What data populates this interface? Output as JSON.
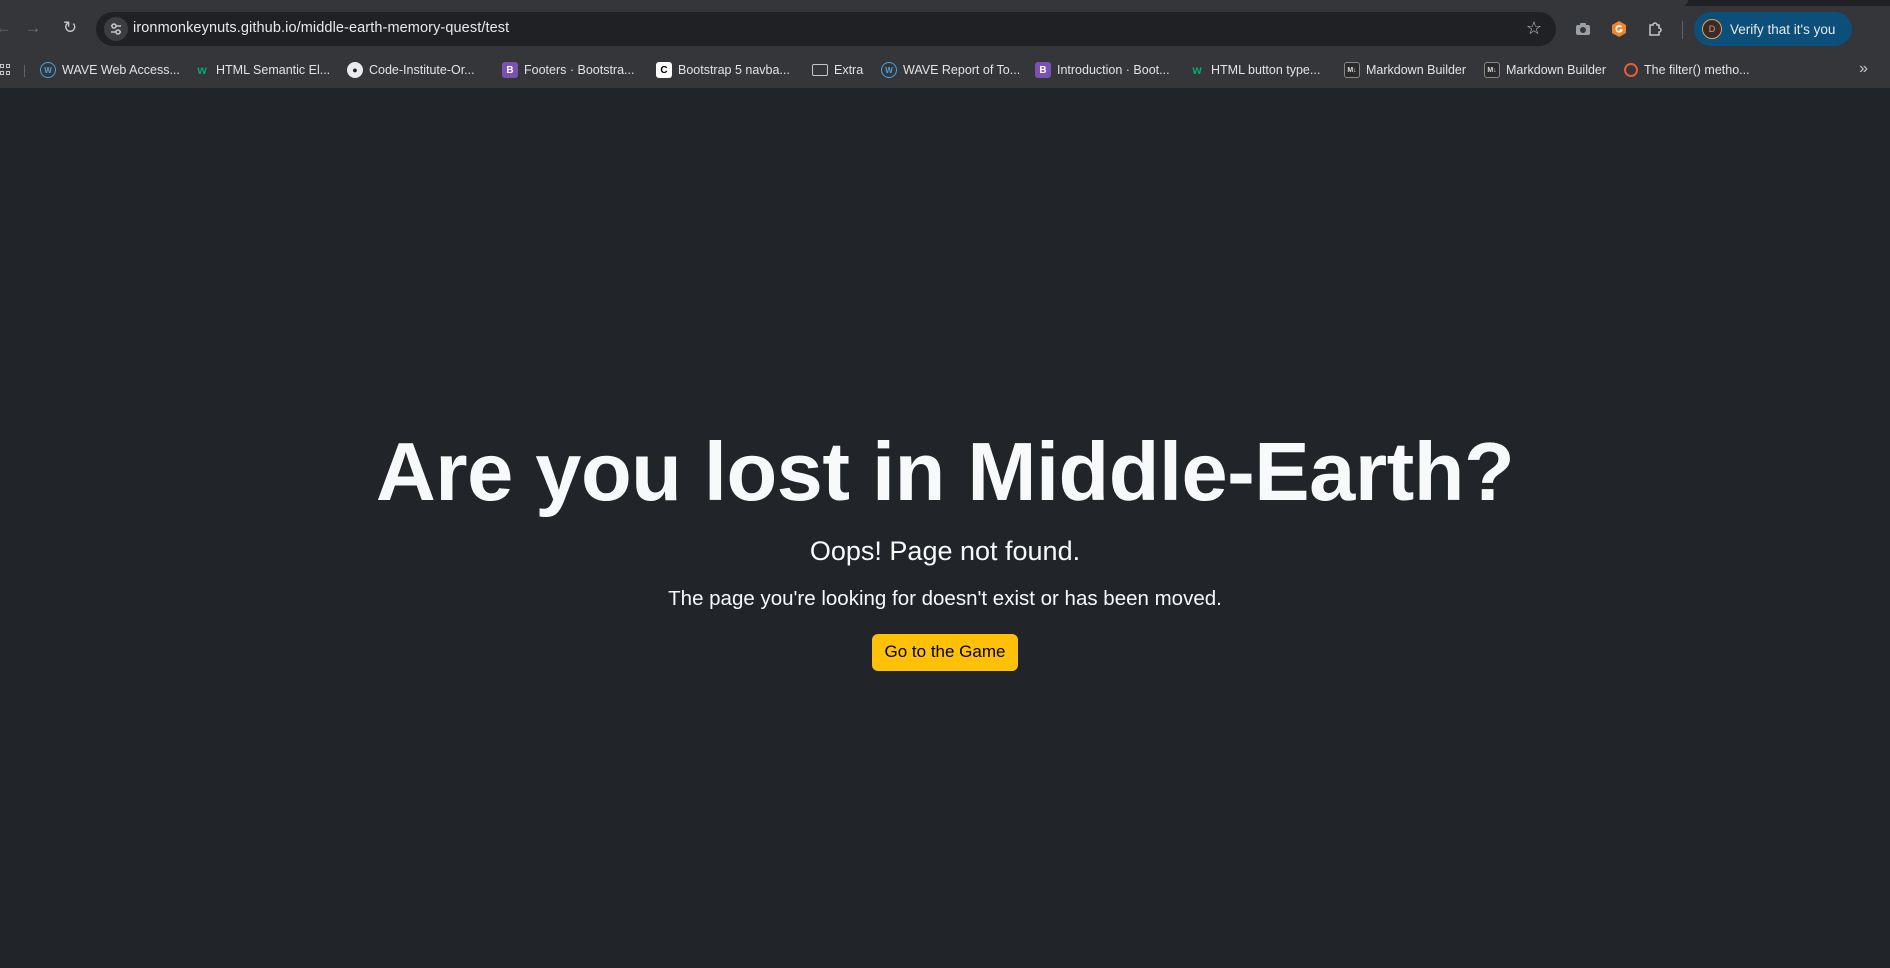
{
  "browser": {
    "url": "ironmonkeynuts.github.io/middle-earth-memory-quest/test",
    "profile_button": "Verify that it's you",
    "profile_initial": "D"
  },
  "bookmarks": [
    {
      "label": "WAVE Web Access...",
      "icon": "wave-icon"
    },
    {
      "label": "HTML Semantic El...",
      "icon": "w3schools-icon"
    },
    {
      "label": "Code-Institute-Or...",
      "icon": "github-icon"
    },
    {
      "label": "Footers · Bootstra...",
      "icon": "bootstrap-icon"
    },
    {
      "label": "Bootstrap 5 navba...",
      "icon": "codeply-icon"
    },
    {
      "label": "Extra",
      "icon": "folder-icon"
    },
    {
      "label": "WAVE Report of To...",
      "icon": "wave-icon"
    },
    {
      "label": "Introduction · Boot...",
      "icon": "bootstrap-icon"
    },
    {
      "label": "HTML button type...",
      "icon": "w3schools-icon"
    },
    {
      "label": "Markdown Builder",
      "icon": "markdown-icon"
    },
    {
      "label": "Markdown Builder",
      "icon": "markdown-icon"
    },
    {
      "label": "The filter() metho...",
      "icon": "mdn-icon"
    }
  ],
  "page": {
    "heading": "Are you lost in Middle-Earth?",
    "subheading": "Oops! Page not found.",
    "description": "The page you're looking for doesn't exist or has been moved.",
    "button_label": "Go to the Game"
  },
  "colors": {
    "page_background": "#212529",
    "button": "#ffc107",
    "profile_pill": "#0b4f7a"
  }
}
